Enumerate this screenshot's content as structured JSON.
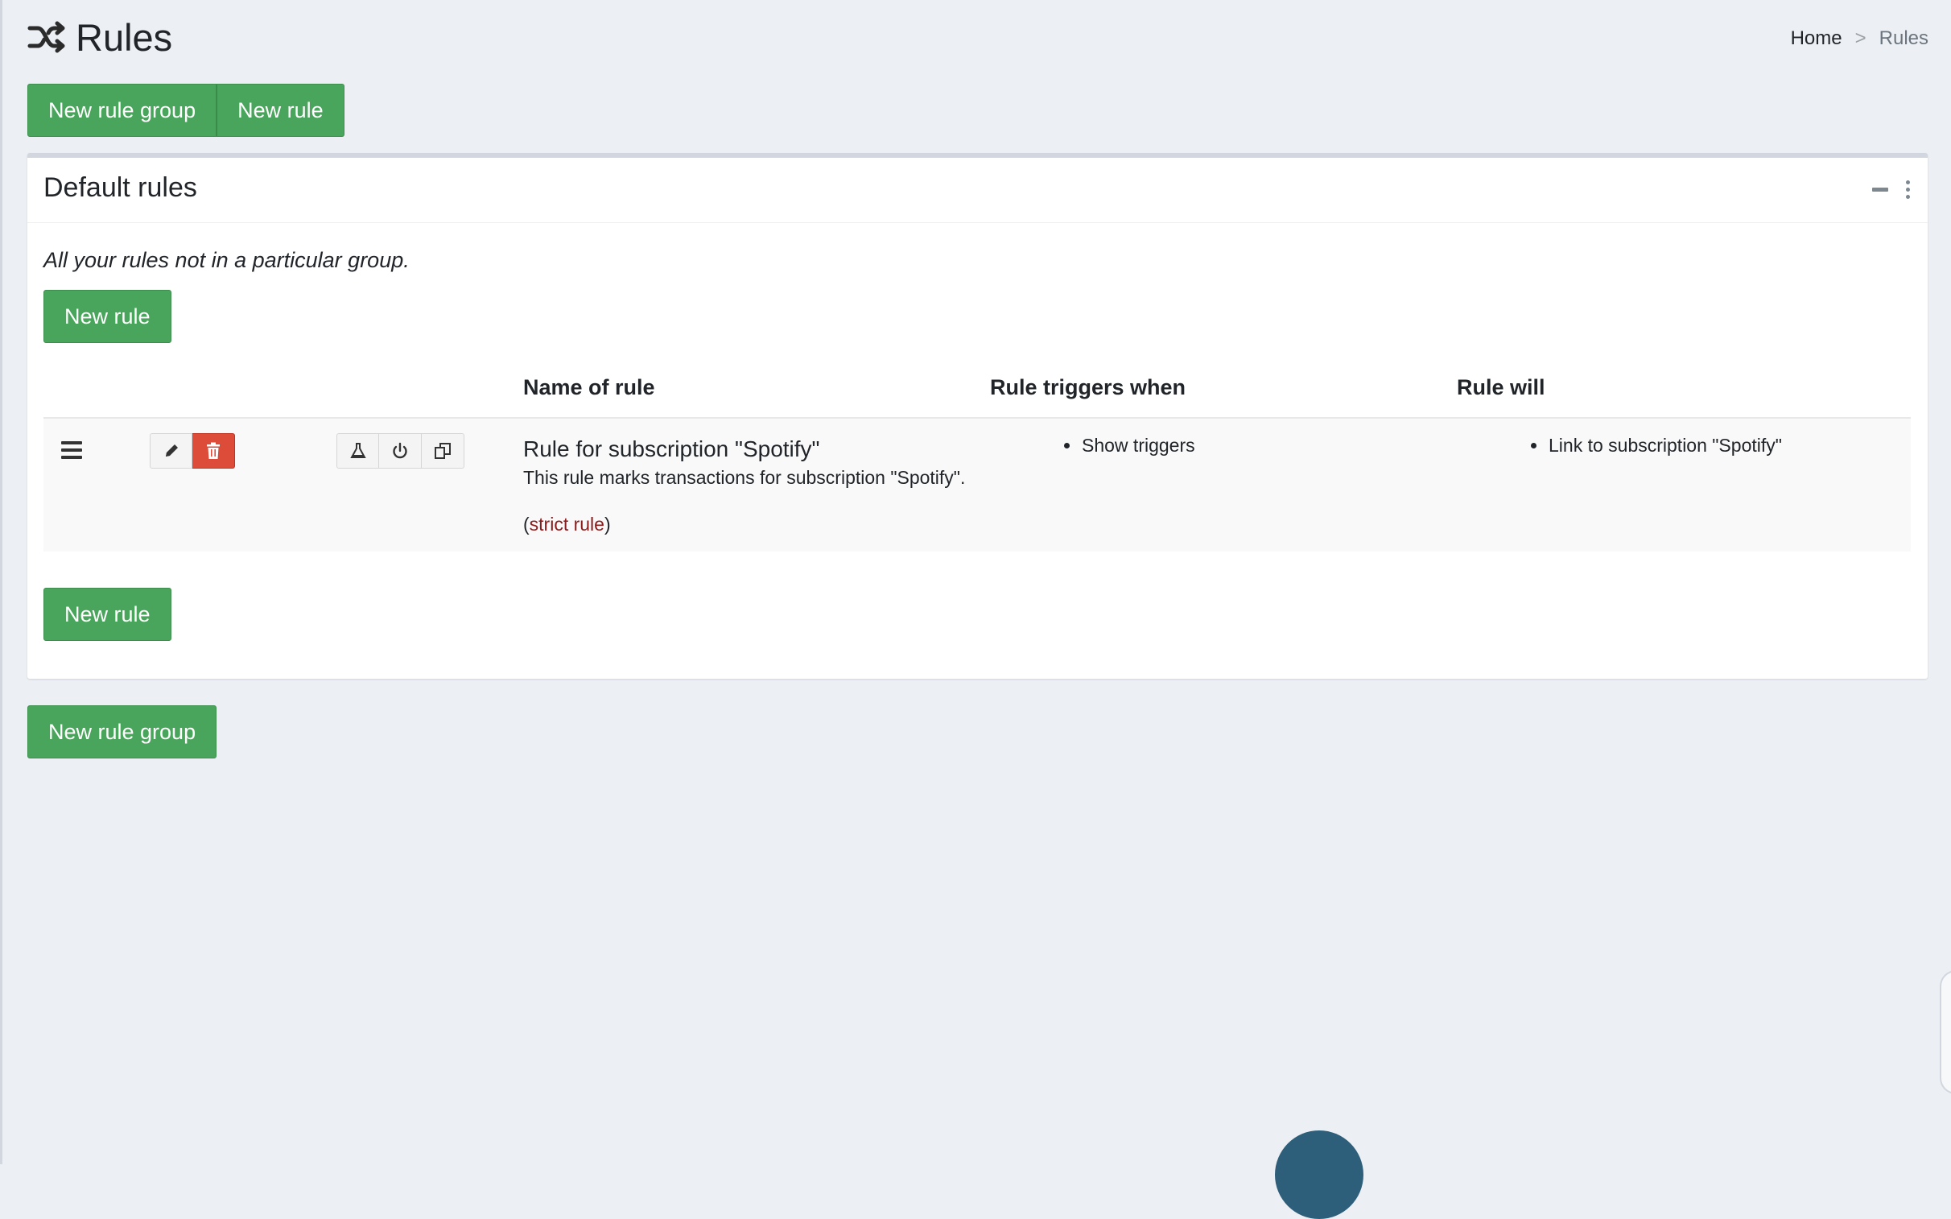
{
  "page": {
    "title": "Rules",
    "title_icon": "shuffle-icon"
  },
  "breadcrumb": {
    "home": "Home",
    "separator": ">",
    "current": "Rules"
  },
  "top_actions": {
    "new_rule_group": "New rule group",
    "new_rule": "New rule"
  },
  "card": {
    "title": "Default rules",
    "description": "All your rules not in a particular group.",
    "new_rule_top": "New rule",
    "new_rule_bottom": "New rule",
    "tools": [
      "minus-icon",
      "vertical-dots-icon"
    ]
  },
  "table": {
    "headers": {
      "name": "Name of rule",
      "triggers": "Rule triggers when",
      "actions": "Rule will"
    },
    "rows": [
      {
        "name": "Rule for subscription \"Spotify\"",
        "description": "This rule marks transactions for subscription \"Spotify\".",
        "strict_open": "(",
        "strict_label": "strict rule",
        "strict_close": ")",
        "triggers": [
          "Show triggers"
        ],
        "actions": [
          "Link to subscription \"Spotify\""
        ],
        "icons": [
          "drag-handle-icon",
          "pencil-icon",
          "trash-icon",
          "flask-icon",
          "power-icon",
          "duplicate-icon"
        ]
      }
    ]
  },
  "bottom_actions": {
    "new_rule_group": "New rule group"
  },
  "colors": {
    "primary_green": "#49a55b",
    "danger_red": "#dd4b39",
    "background": "#ecf0f5",
    "link_red": "#8b1a1a"
  }
}
